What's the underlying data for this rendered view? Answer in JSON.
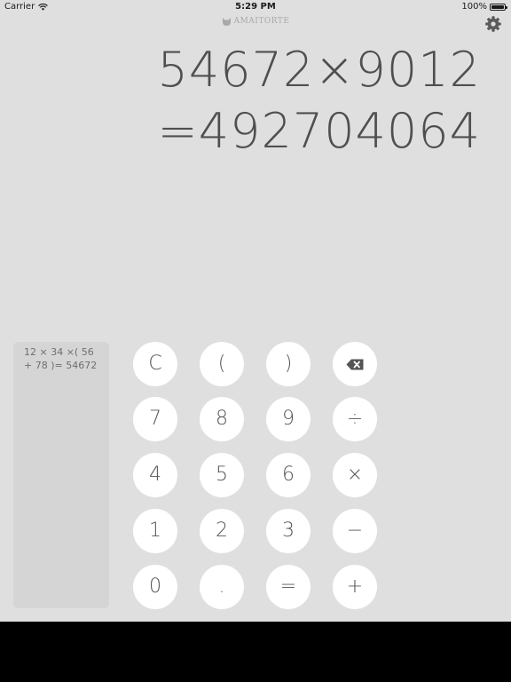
{
  "status_bar": {
    "carrier": "Carrier",
    "time": "5:29 PM",
    "battery": "100%"
  },
  "brand": {
    "name": "AMAITORTE",
    "icon": "cat-icon"
  },
  "settings": {
    "icon": "gear-icon"
  },
  "display": {
    "expression": "54672×9012",
    "result": "=492704064"
  },
  "history": {
    "entries": [
      "12 × 34 ×( 56 + 78 )= 54672"
    ]
  },
  "keypad": {
    "clear": "C",
    "open_paren": "(",
    "close_paren": ")",
    "backspace_icon": "backspace-icon",
    "seven": "7",
    "eight": "8",
    "nine": "9",
    "divide": "÷",
    "four": "4",
    "five": "5",
    "six": "6",
    "multiply": "×",
    "one": "1",
    "two": "2",
    "three": "3",
    "minus": "−",
    "zero": "0",
    "dot": ".",
    "equals": "=",
    "plus": "+"
  },
  "colors": {
    "background": "#dfdfdf",
    "display_text": "#4f4f4f",
    "key_background": "#ffffff",
    "history_panel": "#d5d5d5",
    "brand_text": "#a9a9a9"
  }
}
